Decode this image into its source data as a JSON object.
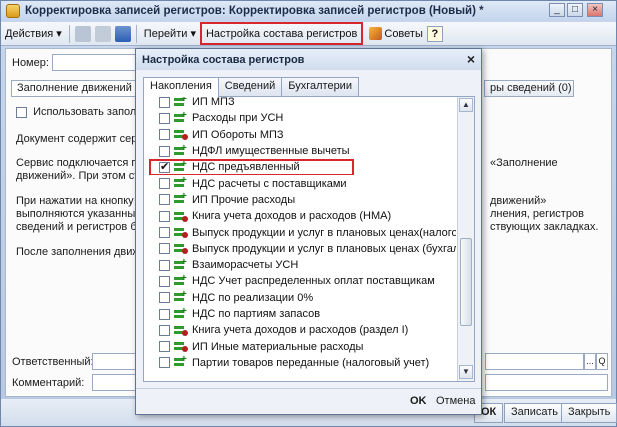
{
  "window": {
    "title": "Корректировка записей регистров: Корректировка записей регистров (Новый) *",
    "controls": [
      "_",
      "□",
      "×"
    ]
  },
  "toolbar": {
    "actions_label": "Действия",
    "goto_label": "Перейти",
    "register_setup_label": "Настройка состава регистров",
    "tips_label": "Советы",
    "help_label": "?"
  },
  "form": {
    "number_label": "Номер:",
    "tab_fill": "Заполнение движений",
    "tab_right": "ры сведений (0)",
    "use_fill_label": "Использовать заполн",
    "doc_contains_text": "Документ содержит серв",
    "service_text_1": "Сервис подключается пр",
    "service_text_1_right": "«Заполнение",
    "service_text_2": "движений». При этом ст",
    "press_text_1": "При нажатии на кнопку",
    "press_text_1_right": "движений»",
    "press_text_2": "выполняются указанные",
    "press_text_2_right": "лнения, регистров",
    "press_text_3": "сведений и регистров бу",
    "press_text_3_right": "ствующих закладках.",
    "after_fill_text": "После заполнения движ",
    "responsible_label": "Ответственный:",
    "comment_label": "Комментарий:",
    "more_btn": "...",
    "lookup_btn": "Q"
  },
  "bottom": {
    "ok_label": "ОК",
    "save_label": "Записать",
    "close_label": "Закрыть"
  },
  "dialog": {
    "title": "Настройка состава регистров",
    "close": "×",
    "tabs": [
      "Накопления",
      "Сведений",
      "Бухгалтерии"
    ],
    "items": [
      {
        "label": "ИП МПЗ",
        "checked": false,
        "icon": "accumulation-register-icon"
      },
      {
        "label": "Расходы при УСН",
        "checked": false,
        "icon": "accumulation-register-icon"
      },
      {
        "label": "ИП Обороты МПЗ",
        "checked": false,
        "icon": "turnover-register-icon"
      },
      {
        "label": "НДФЛ имущественные вычеты",
        "checked": false,
        "icon": "accumulation-register-icon"
      },
      {
        "label": "НДС предъявленный",
        "checked": true,
        "icon": "accumulation-register-icon",
        "highlighted": true
      },
      {
        "label": "НДС расчеты с поставщиками",
        "checked": false,
        "icon": "accumulation-register-icon"
      },
      {
        "label": "ИП Прочие расходы",
        "checked": false,
        "icon": "accumulation-register-icon"
      },
      {
        "label": "Книга учета доходов и расходов (НМА)",
        "checked": false,
        "icon": "turnover-register-icon"
      },
      {
        "label": "Выпуск продукции  и услуг в плановых ценах(налогов...",
        "checked": false,
        "icon": "turnover-register-icon"
      },
      {
        "label": "Выпуск продукции и услуг в плановых ценах (бухгалт...",
        "checked": false,
        "icon": "turnover-register-icon"
      },
      {
        "label": "Взаиморасчеты УСН",
        "checked": false,
        "icon": "accumulation-register-icon"
      },
      {
        "label": "НДС Учет распределенных оплат поставщикам",
        "checked": false,
        "icon": "accumulation-register-icon"
      },
      {
        "label": "НДС по реализации 0%",
        "checked": false,
        "icon": "accumulation-register-icon"
      },
      {
        "label": "НДС по партиям запасов",
        "checked": false,
        "icon": "accumulation-register-icon"
      },
      {
        "label": "Книга учета доходов и расходов (раздел I)",
        "checked": false,
        "icon": "turnover-register-icon"
      },
      {
        "label": "ИП Иные материальные расходы",
        "checked": false,
        "icon": "turnover-register-icon"
      },
      {
        "label": "Партии товаров переданные (налоговый учет)",
        "checked": false,
        "icon": "accumulation-register-icon"
      }
    ],
    "ok_label": "OK",
    "cancel_label": "Отмена"
  }
}
